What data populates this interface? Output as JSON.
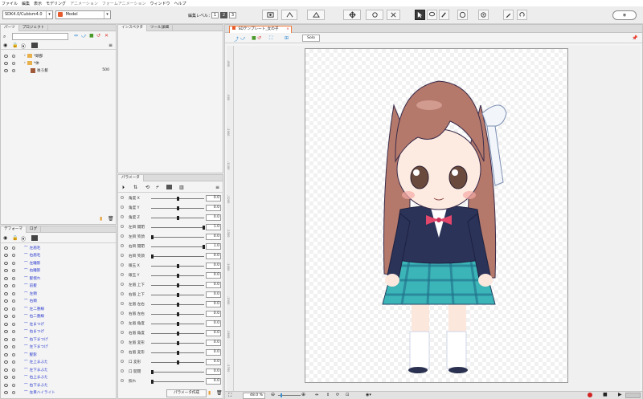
{
  "menubar": [
    "ファイル",
    "編集",
    "表示",
    "モデリング",
    "アニメーション",
    "フォームアニメーション",
    "ウィンドウ",
    "ヘルプ"
  ],
  "toolbar": {
    "sdk_select": "SDK4.0/Cubism4.0",
    "mode_select": "Model",
    "edit_level_label": "編集レベル：",
    "edit_levels": [
      "1",
      "2",
      "3"
    ]
  },
  "parts_panel": {
    "tabs": [
      "パーツ",
      "プロジェクト"
    ],
    "items": [
      {
        "name": "*頭部",
        "value": ""
      },
      {
        "name": "*体",
        "value": ""
      },
      {
        "name": "後ろ髪",
        "value": "500"
      }
    ]
  },
  "inspector_panel": {
    "tabs": [
      "インスペクタ",
      "ツール詳細"
    ]
  },
  "deformer_panel": {
    "tabs": [
      "デフォーマ",
      "ログ"
    ],
    "items": [
      "左眉毛",
      "右眉毛",
      "左瞳影",
      "右瞳影",
      "髪揺れ",
      "前髪",
      "左頬",
      "右頬",
      "左二重線",
      "右二重線",
      "左まつげ",
      "右まつげ",
      "右下まつげ",
      "左下まつげ",
      "髪影",
      "左上まぶた",
      "左下まぶた",
      "右上まぶた",
      "右下まぶた",
      "左目ハイライト"
    ]
  },
  "parameter_panel": {
    "tab": "パラメータ",
    "create_button": "パラメータ作成",
    "params": [
      {
        "label": "角度 X",
        "value": "0.0",
        "pos": 0.5
      },
      {
        "label": "角度 Y",
        "value": "0.0",
        "pos": 0.5
      },
      {
        "label": "角度 Z",
        "value": "0.0",
        "pos": 0.5
      },
      {
        "label": "左目 開閉",
        "value": "1.0",
        "pos": 1.0
      },
      {
        "label": "左目 笑顔",
        "value": "0.0",
        "pos": 0.0
      },
      {
        "label": "右目 開閉",
        "value": "1.0",
        "pos": 1.0
      },
      {
        "label": "右目 笑顔",
        "value": "0.0",
        "pos": 0.0
      },
      {
        "label": "眼玉 X",
        "value": "0.0",
        "pos": 0.5
      },
      {
        "label": "眼玉 Y",
        "value": "0.0",
        "pos": 0.5
      },
      {
        "label": "左眉 上下",
        "value": "0.0",
        "pos": 0.5
      },
      {
        "label": "右眉 上下",
        "value": "0.0",
        "pos": 0.5
      },
      {
        "label": "左眉 左右",
        "value": "0.0",
        "pos": 0.5
      },
      {
        "label": "右眉 左右",
        "value": "0.0",
        "pos": 0.5
      },
      {
        "label": "左眉 角度",
        "value": "0.0",
        "pos": 0.5
      },
      {
        "label": "右眉 角度",
        "value": "0.0",
        "pos": 0.5
      },
      {
        "label": "左眉 変形",
        "value": "0.0",
        "pos": 0.5
      },
      {
        "label": "右眉 変形",
        "value": "0.0",
        "pos": 0.5
      },
      {
        "label": "口 変形",
        "value": "0.0",
        "pos": 0.5
      },
      {
        "label": "口 開閉",
        "value": "0.0",
        "pos": 0.0
      },
      {
        "label": "照れ",
        "value": "0.0",
        "pos": 0.0
      }
    ]
  },
  "canvas": {
    "tab_title": "SDテンプレート_女の子",
    "solo_button": "Solo",
    "ruler_labels": [
      "-800",
      "-900",
      "-1000",
      "-1100",
      "-1200",
      "-1300",
      "-1400",
      "-1500",
      "-1600",
      "-1700",
      "-1800"
    ],
    "zoom": "48.0",
    "zoom_unit": "%"
  },
  "colors": {
    "accent": "#f07a3c",
    "deformer_text": "#2233cc",
    "record": "#d22222"
  }
}
